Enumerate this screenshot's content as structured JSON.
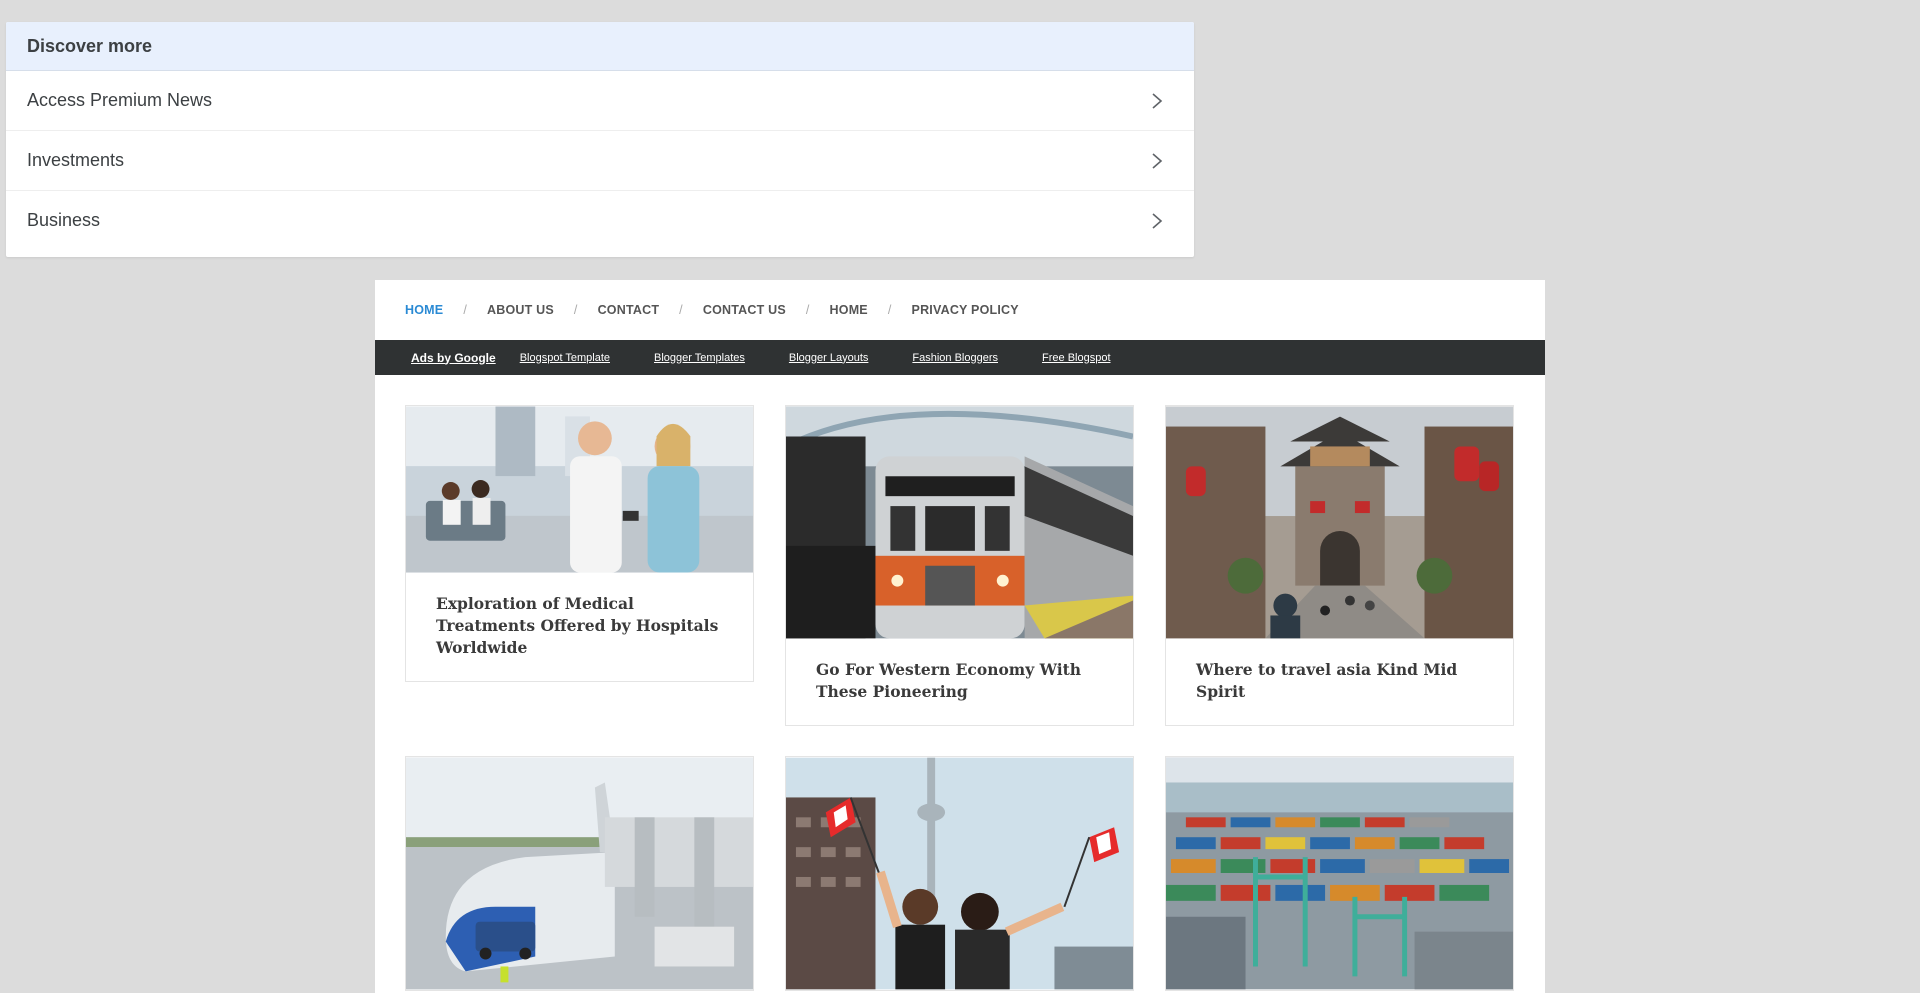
{
  "discover": {
    "title": "Discover more",
    "items": [
      {
        "label": "Access Premium News"
      },
      {
        "label": "Investments"
      },
      {
        "label": "Business"
      }
    ]
  },
  "nav": {
    "items": [
      "HOME",
      "ABOUT US",
      "CONTACT",
      "CONTACT US",
      "HOME",
      "PRIVACY POLICY"
    ],
    "separator": "/",
    "active_color": "#2a8ad4"
  },
  "adbar": {
    "ads_by": "Ads by Google",
    "links": [
      "Blogspot Template",
      "Blogger Templates",
      "Blogger Layouts",
      "Fashion Bloggers",
      "Free Blogspot"
    ]
  },
  "posts": [
    {
      "title": "Exploration of Medical Treatments Offered by Hospitals Worldwide",
      "image": "airport-lounge-couple"
    },
    {
      "title": "Go For Western Economy With These Pioneering",
      "image": "subway-train"
    },
    {
      "title": "Where to travel asia Kind Mid Spirit",
      "image": "asian-old-town-gate"
    },
    {
      "title": "",
      "image": "airplane-at-gate"
    },
    {
      "title": "",
      "image": "women-with-canadian-flags"
    },
    {
      "title": "",
      "image": "container-port"
    }
  ]
}
